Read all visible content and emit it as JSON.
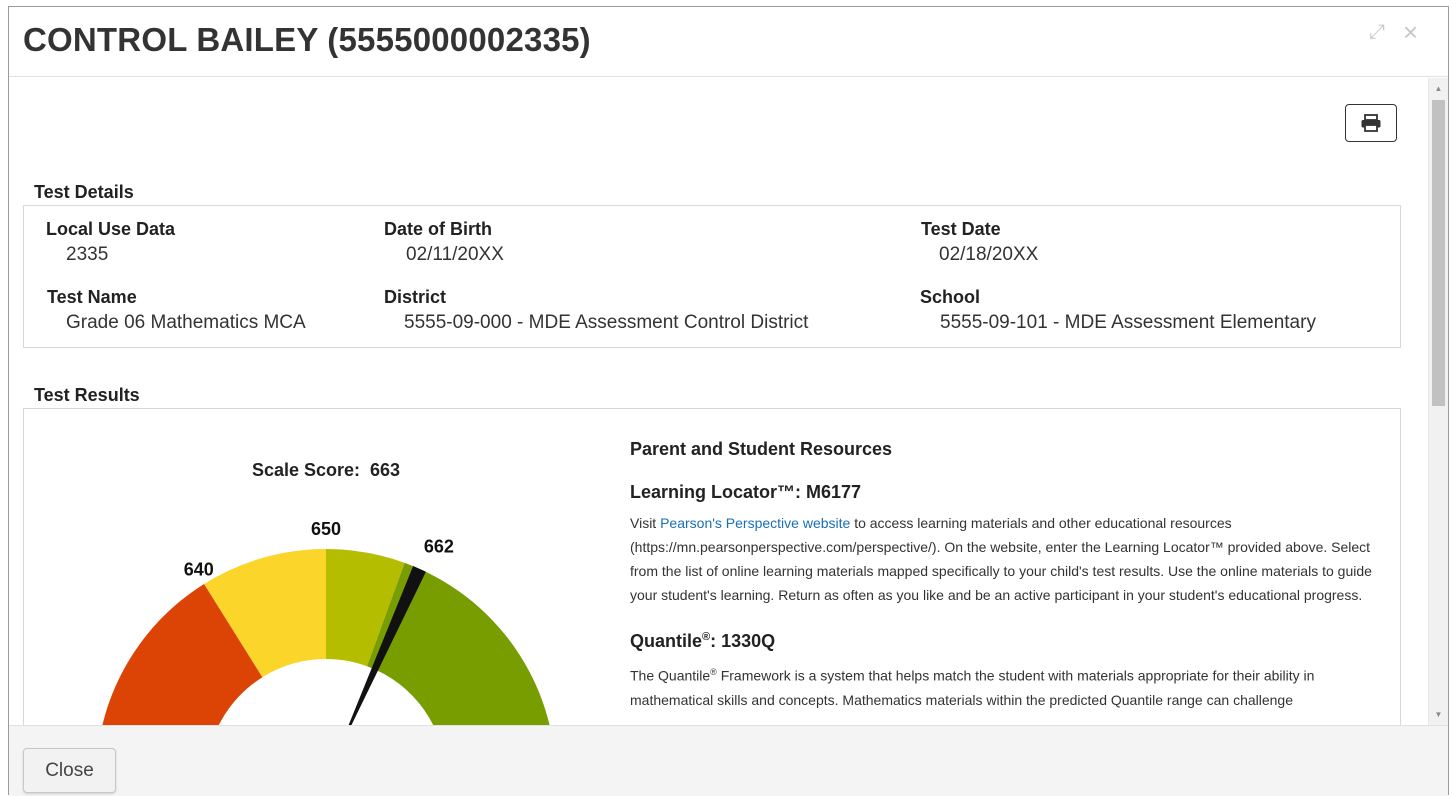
{
  "header": {
    "title": "CONTROL BAILEY (5555000002335)",
    "expand_icon": "expand-icon",
    "close_icon": "close-icon"
  },
  "toolbar": {
    "print_icon": "printer-icon"
  },
  "test_details": {
    "title": "Test Details",
    "local_use_data": {
      "label": "Local Use Data",
      "value": "2335"
    },
    "date_of_birth": {
      "label": "Date of Birth",
      "value": "02/11/20XX"
    },
    "test_date": {
      "label": "Test Date",
      "value": "02/18/20XX"
    },
    "test_name": {
      "label": "Test Name",
      "value": "Grade 06 Mathematics MCA"
    },
    "district": {
      "label": "District",
      "value": "5555-09-000 - MDE Assessment Control District"
    },
    "school": {
      "label": "School",
      "value": "5555-09-101 - MDE Assessment Elementary"
    }
  },
  "test_results": {
    "title": "Test Results",
    "gauge": {
      "label": "Scale Score:",
      "score": "663",
      "score_value": 663,
      "tick_labels": [
        "640",
        "650",
        "662"
      ],
      "bands": [
        {
          "color": "#dc4405"
        },
        {
          "color": "#fbd52a"
        },
        {
          "color": "#b5bd00"
        },
        {
          "color": "#789d00"
        }
      ],
      "needle_color": "#111111"
    },
    "resources": {
      "heading": "Parent and Student Resources",
      "learning_locator": {
        "title": "Learning Locator™: M6177",
        "text_before": "Visit ",
        "link_text": "Pearson's Perspective website",
        "text_after": " to access learning materials and other educational resources (https://mn.pearsonperspective.com/perspective/). On the website, enter the Learning Locator™ provided above. Select from the list of online learning materials mapped specifically to your child's test results. Use the online materials to guide your student's learning. Return as often as you like and be an active participant in your student's educational progress."
      },
      "quantile": {
        "title_word": "Quantile",
        "reg": "®",
        "title_rest": ": 1330Q",
        "text_a": "The Quantile",
        "text_reg": "®",
        "text_b": " Framework is a system that helps match the student with materials appropriate for their ability in mathematical skills and concepts. Mathematics materials within the predicted Quantile range can challenge"
      }
    }
  },
  "footer": {
    "close_label": "Close"
  }
}
